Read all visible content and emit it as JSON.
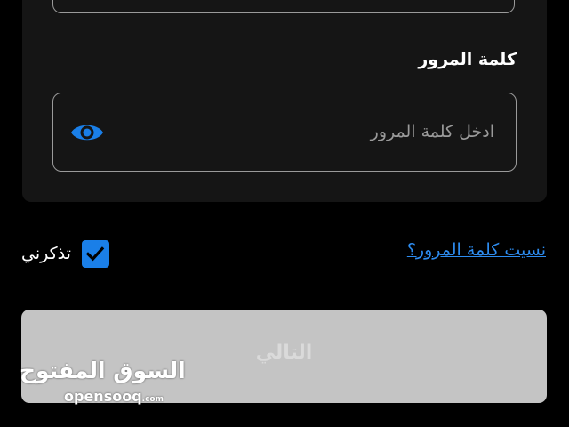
{
  "form": {
    "password_label": "كلمة المرور",
    "password_placeholder": "ادخل كلمة المرور",
    "password_value": ""
  },
  "options": {
    "remember_label": "تذكرني",
    "remember_checked": true,
    "forgot_password_label": "نسيت كلمة المرور؟"
  },
  "actions": {
    "next_label": "التالي",
    "next_enabled": false
  },
  "watermark": {
    "arabic": "السوق المفتوح",
    "latin": "opensooq",
    "suffix": ".com"
  },
  "colors": {
    "background": "#000000",
    "card": "#151515",
    "accent": "#1a7fe8",
    "link": "#2d8cf0",
    "disabled_button": "#c4c4c4"
  },
  "icons": {
    "password_toggle": "eye-icon",
    "checkbox_mark": "checkmark-icon"
  }
}
